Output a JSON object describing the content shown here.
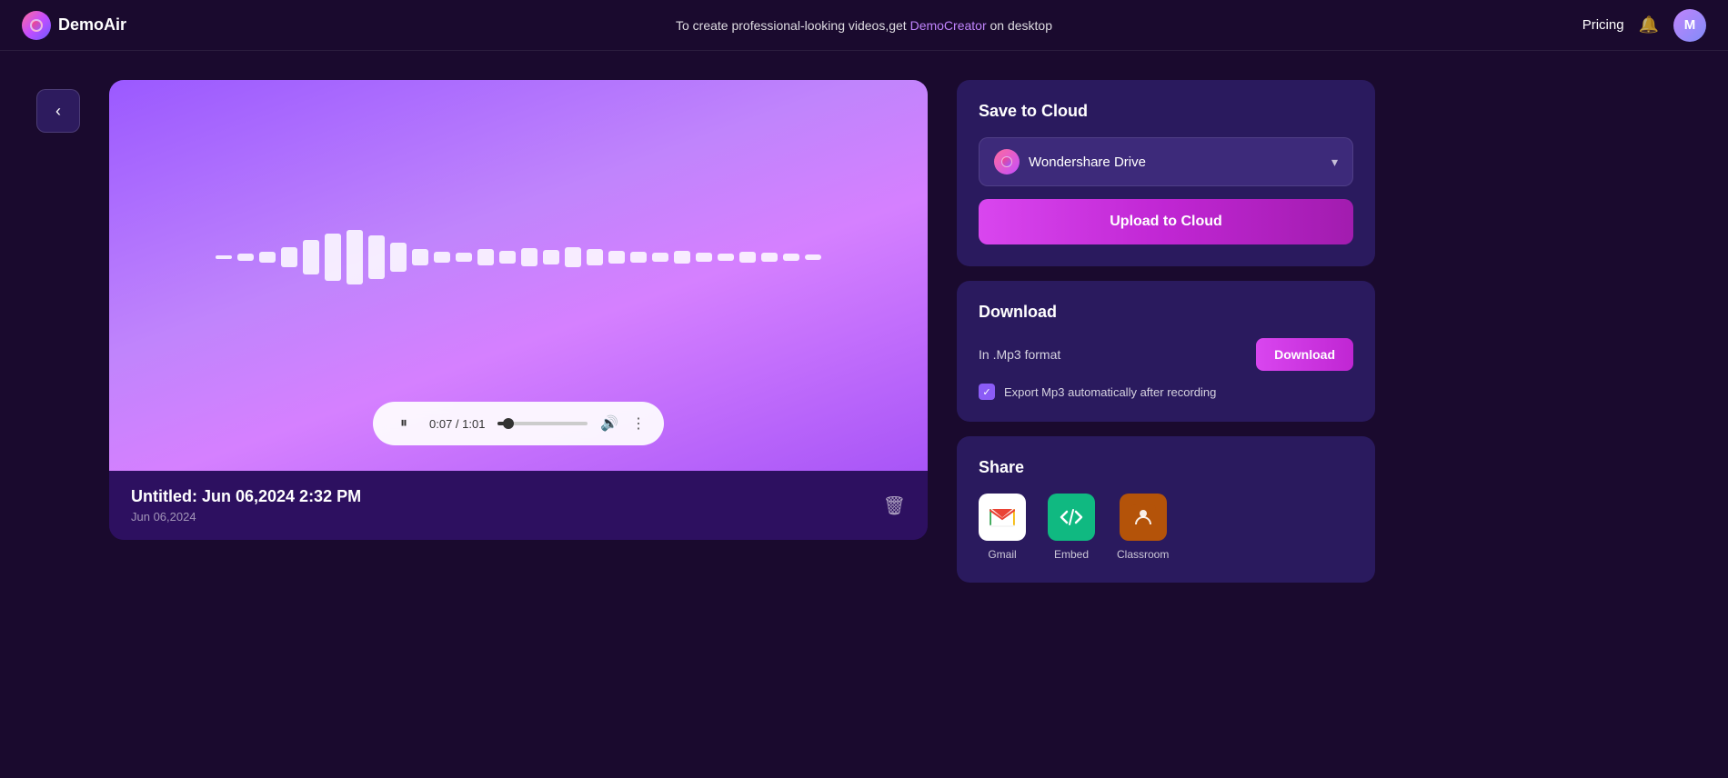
{
  "header": {
    "logo_text": "DemoAir",
    "promo_before": "To create professional-looking videos,get ",
    "promo_link": "DemoCreator",
    "promo_after": " on desktop",
    "pricing_label": "Pricing",
    "avatar_letter": "M"
  },
  "back_button": "‹",
  "media": {
    "title": "Untitled: Jun 06,2024 2:32 PM",
    "date": "Jun 06,2024",
    "current_time": "0:07",
    "total_time": "1:01",
    "progress_percent": 12
  },
  "save_to_cloud": {
    "title": "Save to Cloud",
    "provider": "Wondershare Drive",
    "upload_button": "Upload to Cloud"
  },
  "download": {
    "title": "Download",
    "format_label": "In .Mp3 format",
    "button_label": "Download",
    "checkbox_label": "Export Mp3 automatically after recording",
    "checkbox_checked": true
  },
  "share": {
    "title": "Share",
    "items": [
      {
        "id": "gmail",
        "label": "Gmail"
      },
      {
        "id": "embed",
        "label": "Embed"
      },
      {
        "id": "classroom",
        "label": "Classroom"
      }
    ]
  },
  "waveform_bars": [
    4,
    8,
    12,
    22,
    38,
    52,
    60,
    48,
    32,
    18,
    12,
    10,
    18,
    14,
    20,
    16,
    22,
    18,
    14,
    12,
    10,
    14,
    10,
    8,
    12,
    10,
    8,
    6
  ]
}
